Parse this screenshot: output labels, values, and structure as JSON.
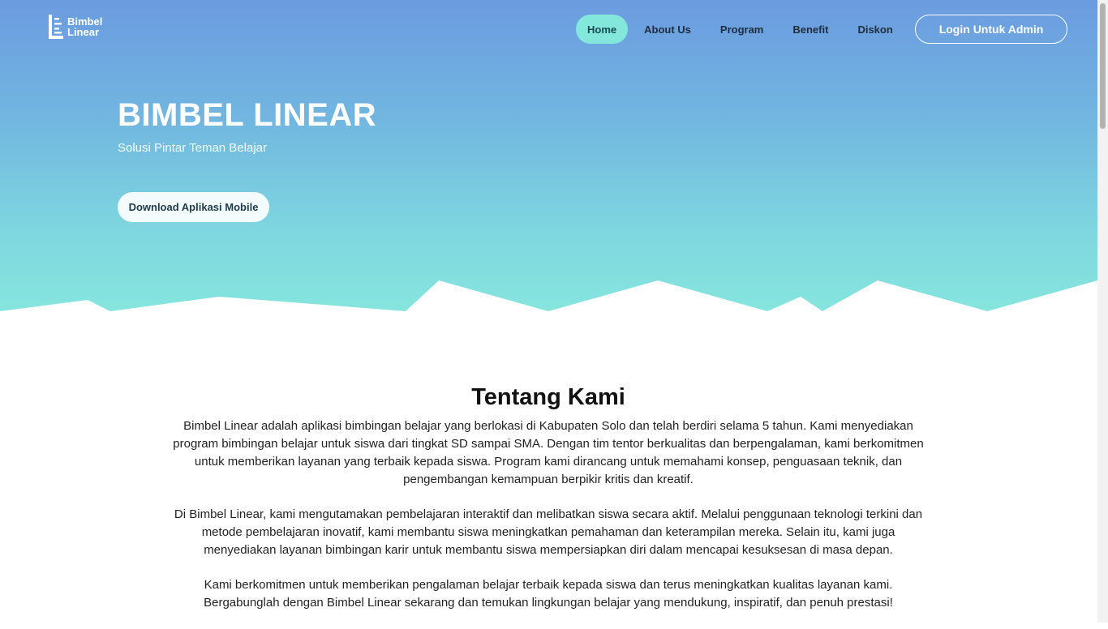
{
  "brand": {
    "name_line1": "Bimbel",
    "name_line2": "Linear",
    "logo_icon": "bars-logo-icon"
  },
  "nav": {
    "items": [
      {
        "label": "Home",
        "active": true
      },
      {
        "label": "About Us",
        "active": false
      },
      {
        "label": "Program",
        "active": false
      },
      {
        "label": "Benefit",
        "active": false
      },
      {
        "label": "Diskon",
        "active": false
      }
    ],
    "login_label": "Login Untuk Admin"
  },
  "hero": {
    "title": "BIMBEL LINEAR",
    "subtitle": "Solusi Pintar Teman Belajar",
    "cta_label": "Download Aplikasi Mobile"
  },
  "about": {
    "title": "Tentang Kami",
    "paragraphs": [
      "Bimbel Linear adalah aplikasi bimbingan belajar yang berlokasi di Kabupaten Solo dan telah berdiri selama 5 tahun. Kami menyediakan program bimbingan belajar untuk siswa dari tingkat SD sampai SMA. Dengan tim tentor berkualitas dan berpengalaman, kami berkomitmen untuk memberikan layanan yang terbaik kepada siswa. Program kami dirancang untuk memahami konsep, penguasaan teknik, dan pengembangan kemampuan berpikir kritis dan kreatif.",
      "Di Bimbel Linear, kami mengutamakan pembelajaran interaktif dan melibatkan siswa secara aktif. Melalui penggunaan teknologi terkini dan metode pembelajaran inovatif, kami membantu siswa meningkatkan pemahaman dan keterampilan mereka. Selain itu, kami juga menyediakan layanan bimbingan karir untuk membantu siswa mempersiapkan diri dalam mencapai kesuksesan di masa depan.",
      "Kami berkomitmen untuk memberikan pengalaman belajar terbaik kepada siswa dan terus meningkatkan kualitas layanan kami. Bergabunglah dengan Bimbel Linear sekarang dan temukan lingkungan belajar yang mendukung, inspiratif, dan penuh prestasi!"
    ]
  },
  "colors": {
    "hero_top": "#6b9be0",
    "hero_bottom": "#86e6de",
    "active_pill": "#84e7dc"
  }
}
